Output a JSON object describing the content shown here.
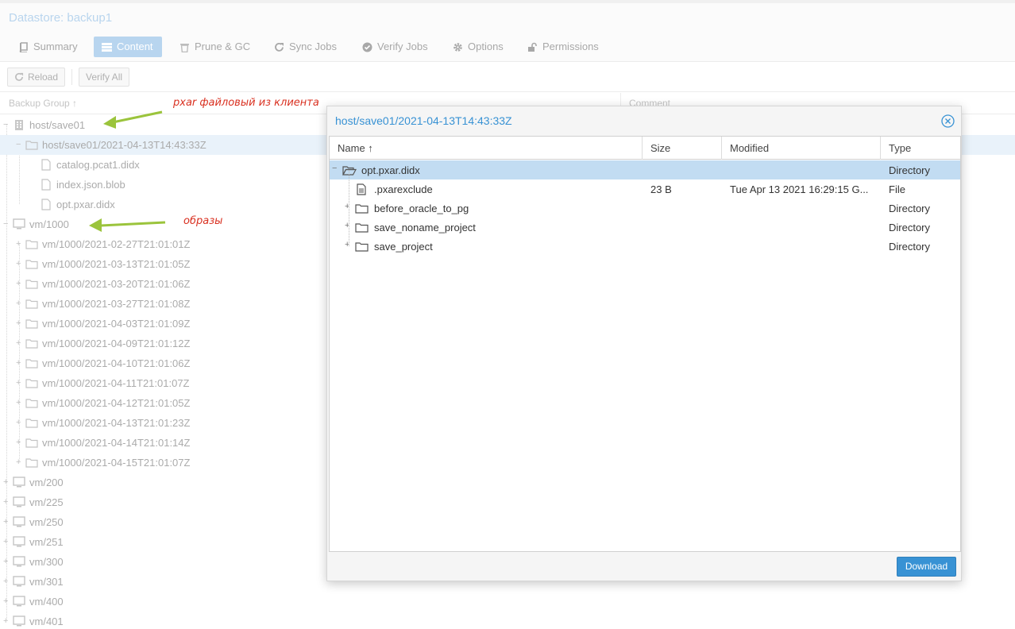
{
  "datastore": {
    "title": "Datastore: backup1"
  },
  "tabs": [
    {
      "label": "Summary",
      "icon": "book-icon"
    },
    {
      "label": "Content",
      "icon": "list-icon",
      "active": true
    },
    {
      "label": "Prune & GC",
      "icon": "trash-icon"
    },
    {
      "label": "Sync Jobs",
      "icon": "refresh-icon"
    },
    {
      "label": "Verify Jobs",
      "icon": "check-circle-icon"
    },
    {
      "label": "Options",
      "icon": "gear-icon"
    },
    {
      "label": "Permissions",
      "icon": "unlock-icon"
    }
  ],
  "toolbar": {
    "reload_label": "Reload",
    "verify_all_label": "Verify All"
  },
  "grid": {
    "columns": {
      "group": "Backup Group ↑",
      "comment": "Comment"
    },
    "rows": [
      {
        "label": "host/save01",
        "kind": "host"
      },
      {
        "label": "host/save01/2021-04-13T14:43:33Z",
        "kind": "snapshot"
      },
      {
        "label": "catalog.pcat1.didx",
        "kind": "file"
      },
      {
        "label": "index.json.blob",
        "kind": "file"
      },
      {
        "label": "opt.pxar.didx",
        "kind": "file"
      },
      {
        "label": "vm/1000",
        "kind": "vm"
      },
      {
        "label": "vm/1000/2021-02-27T21:01:01Z",
        "kind": "snapshot"
      },
      {
        "label": "vm/1000/2021-03-13T21:01:05Z",
        "kind": "snapshot"
      },
      {
        "label": "vm/1000/2021-03-20T21:01:06Z",
        "kind": "snapshot"
      },
      {
        "label": "vm/1000/2021-03-27T21:01:08Z",
        "kind": "snapshot"
      },
      {
        "label": "vm/1000/2021-04-03T21:01:09Z",
        "kind": "snapshot"
      },
      {
        "label": "vm/1000/2021-04-09T21:01:12Z",
        "kind": "snapshot"
      },
      {
        "label": "vm/1000/2021-04-10T21:01:06Z",
        "kind": "snapshot"
      },
      {
        "label": "vm/1000/2021-04-11T21:01:07Z",
        "kind": "snapshot"
      },
      {
        "label": "vm/1000/2021-04-12T21:01:05Z",
        "kind": "snapshot"
      },
      {
        "label": "vm/1000/2021-04-13T21:01:23Z",
        "kind": "snapshot"
      },
      {
        "label": "vm/1000/2021-04-14T21:01:14Z",
        "kind": "snapshot"
      },
      {
        "label": "vm/1000/2021-04-15T21:01:07Z",
        "kind": "snapshot"
      },
      {
        "label": "vm/200",
        "kind": "vm"
      },
      {
        "label": "vm/225",
        "kind": "vm"
      },
      {
        "label": "vm/250",
        "kind": "vm"
      },
      {
        "label": "vm/251",
        "kind": "vm"
      },
      {
        "label": "vm/300",
        "kind": "vm"
      },
      {
        "label": "vm/301",
        "kind": "vm"
      },
      {
        "label": "vm/400",
        "kind": "vm"
      },
      {
        "label": "vm/401",
        "kind": "vm"
      }
    ]
  },
  "annotations": {
    "pxar": "pxar файловый из клиента",
    "images": "образы",
    "arrow_color": "#9bc43c"
  },
  "dialog": {
    "title": "host/save01/2021-04-13T14:43:33Z",
    "columns": {
      "name": "Name ↑",
      "size": "Size",
      "modified": "Modified",
      "type": "Type"
    },
    "rows": [
      {
        "name": "opt.pxar.didx",
        "size": "",
        "modified": "",
        "type": "Directory",
        "kind": "folder-open"
      },
      {
        "name": ".pxarexclude",
        "size": "23 B",
        "modified": "Tue Apr 13 2021 16:29:15 G...",
        "type": "File",
        "kind": "file"
      },
      {
        "name": "before_oracle_to_pg",
        "size": "",
        "modified": "",
        "type": "Directory",
        "kind": "folder"
      },
      {
        "name": "save_noname_project",
        "size": "",
        "modified": "",
        "type": "Directory",
        "kind": "folder"
      },
      {
        "name": "save_project",
        "size": "",
        "modified": "",
        "type": "Directory",
        "kind": "folder"
      }
    ],
    "download_label": "Download"
  },
  "colors": {
    "accent": "#3892d4",
    "selected_row": "#c2dcf2"
  }
}
